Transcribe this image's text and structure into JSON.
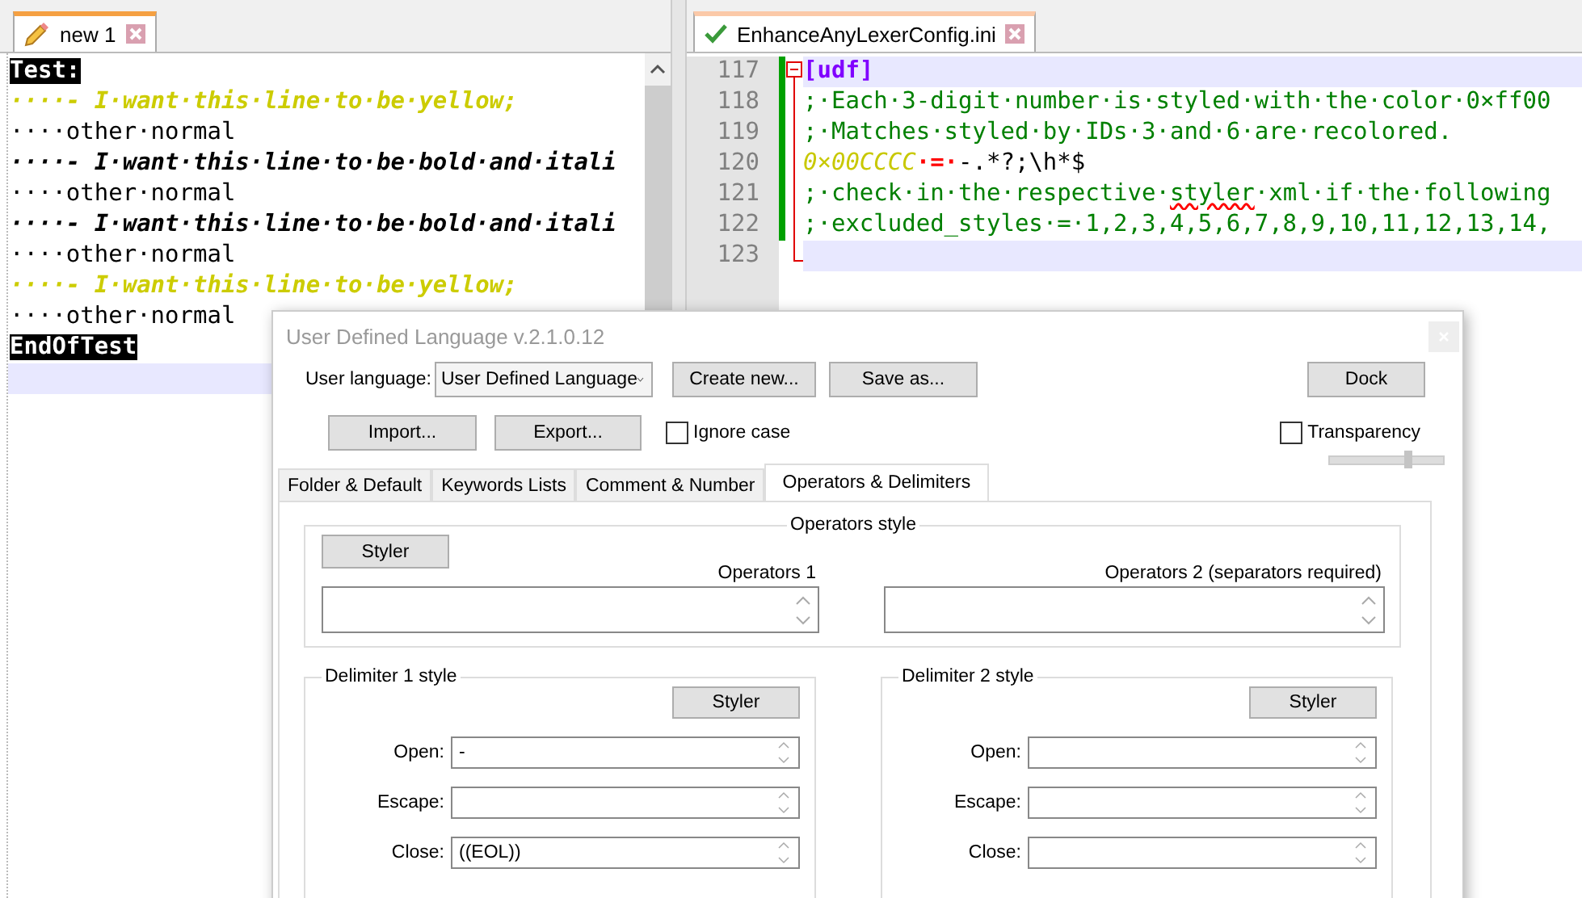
{
  "left_editor": {
    "tab": {
      "label": "new 1"
    },
    "lines": [
      {
        "kind": "heading",
        "text": "Test:"
      },
      {
        "kind": "yellow",
        "text": "····- I·want·this·line·to·be·yellow;"
      },
      {
        "kind": "normal",
        "text": "····other·normal"
      },
      {
        "kind": "bolditalic",
        "text": "····- I·want·this·line·to·be·bold·and·itali"
      },
      {
        "kind": "normal",
        "text": "····other·normal"
      },
      {
        "kind": "bolditalic",
        "text": "····- I·want·this·line·to·be·bold·and·itali"
      },
      {
        "kind": "normal",
        "text": "····other·normal"
      },
      {
        "kind": "yellow",
        "text": "····- I·want·this·line·to·be·yellow;"
      },
      {
        "kind": "normal",
        "text": "····other·normal"
      },
      {
        "kind": "heading",
        "text": "EndOfTest"
      },
      {
        "kind": "current"
      }
    ]
  },
  "right_editor": {
    "tab": {
      "label": "EnhanceAnyLexerConfig.ini"
    },
    "lines": [
      {
        "number": "117",
        "changed": true,
        "kind": "fold_start",
        "highlighted": true,
        "segments": [
          {
            "kind": "section",
            "text": "[udf]"
          }
        ]
      },
      {
        "number": "118",
        "changed": true,
        "kind": "fold_middle",
        "highlighted": false,
        "segments": [
          {
            "kind": "comment",
            "text": ";·Each·3-digit·number·is·styled·with·the·color·0×ff00"
          }
        ]
      },
      {
        "number": "119",
        "changed": true,
        "kind": "fold_middle",
        "highlighted": false,
        "segments": [
          {
            "kind": "comment",
            "text": ";·Matches·styled·by·IDs·3·and·6·are·recolored."
          }
        ]
      },
      {
        "number": "120",
        "changed": true,
        "kind": "fold_middle",
        "highlighted": false,
        "segments": [
          {
            "kind": "number",
            "text": "0×00CCCC"
          },
          {
            "kind": "operator",
            "text": "·=·"
          },
          {
            "kind": "plain",
            "text": "-.*?;\\h*$"
          }
        ]
      },
      {
        "number": "121",
        "changed": true,
        "kind": "fold_middle",
        "highlighted": false,
        "segments": [
          {
            "kind": "comment",
            "text": ";·check·in·the·respective·"
          },
          {
            "kind": "misspelled",
            "text": "styler"
          },
          {
            "kind": "comment",
            "text": "·xml·if·the·following"
          }
        ]
      },
      {
        "number": "122",
        "changed": true,
        "kind": "fold_middle",
        "highlighted": false,
        "segments": [
          {
            "kind": "comment",
            "text": ";·excluded_styles·=·1,2,3,4,5,6,7,8,9,10,11,12,13,14,"
          }
        ]
      },
      {
        "number": "123",
        "changed": false,
        "kind": "fold_end",
        "highlighted": true
      }
    ]
  },
  "dialog": {
    "title": "User Defined Language v.2.1.0.12",
    "language_label": "User language:",
    "language_value": "User Defined Language",
    "create_button": "Create new...",
    "save_button": "Save as...",
    "dock_button": "Dock",
    "import_button": "Import...",
    "export_button": "Export...",
    "ignore_case": {
      "label": "Ignore case",
      "checked": false
    },
    "transparency": {
      "label": "Transparency",
      "checked": false,
      "level": 0.7
    },
    "tabs": [
      {
        "label": "Folder & Default",
        "selected": false
      },
      {
        "label": "Keywords Lists",
        "selected": false
      },
      {
        "label": "Comment & Number",
        "selected": false
      },
      {
        "label": "Operators & Delimiters",
        "selected": true
      }
    ],
    "operators": {
      "title": "Operators style",
      "styler": "Styler",
      "label_1": "Operators 1",
      "label_2": "Operators 2 (separators required)"
    },
    "delimiters": [
      {
        "title": "Delimiter 1 style",
        "styler": "Styler",
        "fields": [
          {
            "label": "Open:",
            "value": "-"
          },
          {
            "label": "Escape:"
          },
          {
            "label": "Close:",
            "value": "((EOL))"
          }
        ]
      },
      {
        "title": "Delimiter 2 style",
        "styler": "Styler",
        "fields": [
          {
            "label": "Open:"
          },
          {
            "label": "Escape:"
          },
          {
            "label": "Close:"
          }
        ]
      }
    ]
  }
}
